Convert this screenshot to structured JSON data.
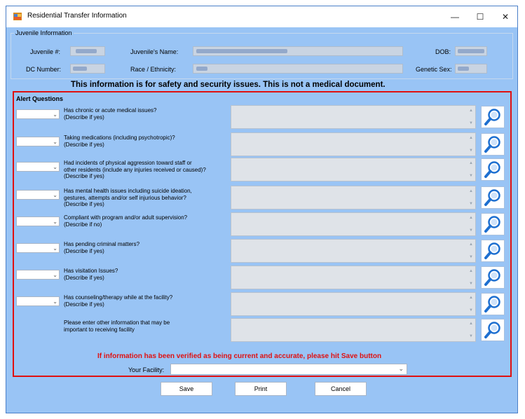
{
  "window": {
    "title": "Residential Transfer Information",
    "minimize": "—",
    "maximize": "☐",
    "close": "✕"
  },
  "juvenile_info": {
    "group_title": "Juvenile Information",
    "juvenile_num_label": "Juvenile #:",
    "name_label": "Juvenile's Name:",
    "dob_label": "DOB:",
    "dc_number_label": "DC Number:",
    "race_label": "Race / Ethnicity:",
    "sex_label": "Genetic Sex:"
  },
  "notice": "This information is for safety and security issues.  This is not a medical document.",
  "alert_questions": {
    "title": "Alert Questions",
    "items": [
      {
        "text": "Has chronic or acute medical issues?\n(Describe if yes)"
      },
      {
        "text": "Taking medications (including psychotropic)?\n(Describe if yes)"
      },
      {
        "text": "Had incidents of physical aggression toward staff or\nother residents (include any injuries received or caused)?\n(Describe if yes)"
      },
      {
        "text": "Has mental health issues including suicide ideation,\ngestures, attempts and/or self injurious behavior?\n(Describe if yes)"
      },
      {
        "text": "Compliant with program and/or adult supervision?\n(Describe if no)"
      },
      {
        "text": "Has pending criminal matters?\n(Describe if yes)"
      },
      {
        "text": "Has visitation Issues?\n(Describe if yes)"
      },
      {
        "text": "Has counseling/therapy while at the facility?\n(Describe if yes)"
      }
    ],
    "other_info": "Please enter other information that may be\nimportant to receiving facility"
  },
  "verify_text": "If information has been verified as being current and accurate, please hit Save button",
  "facility": {
    "label": "Your Facility:",
    "value": ""
  },
  "buttons": {
    "save": "Save",
    "print": "Print",
    "cancel": "Cancel"
  },
  "colors": {
    "window_bg": "#99c4f5",
    "alert_red": "#e01010"
  },
  "icons": {
    "search": "magnifier-icon",
    "dropdown": "chevron-down-icon"
  }
}
